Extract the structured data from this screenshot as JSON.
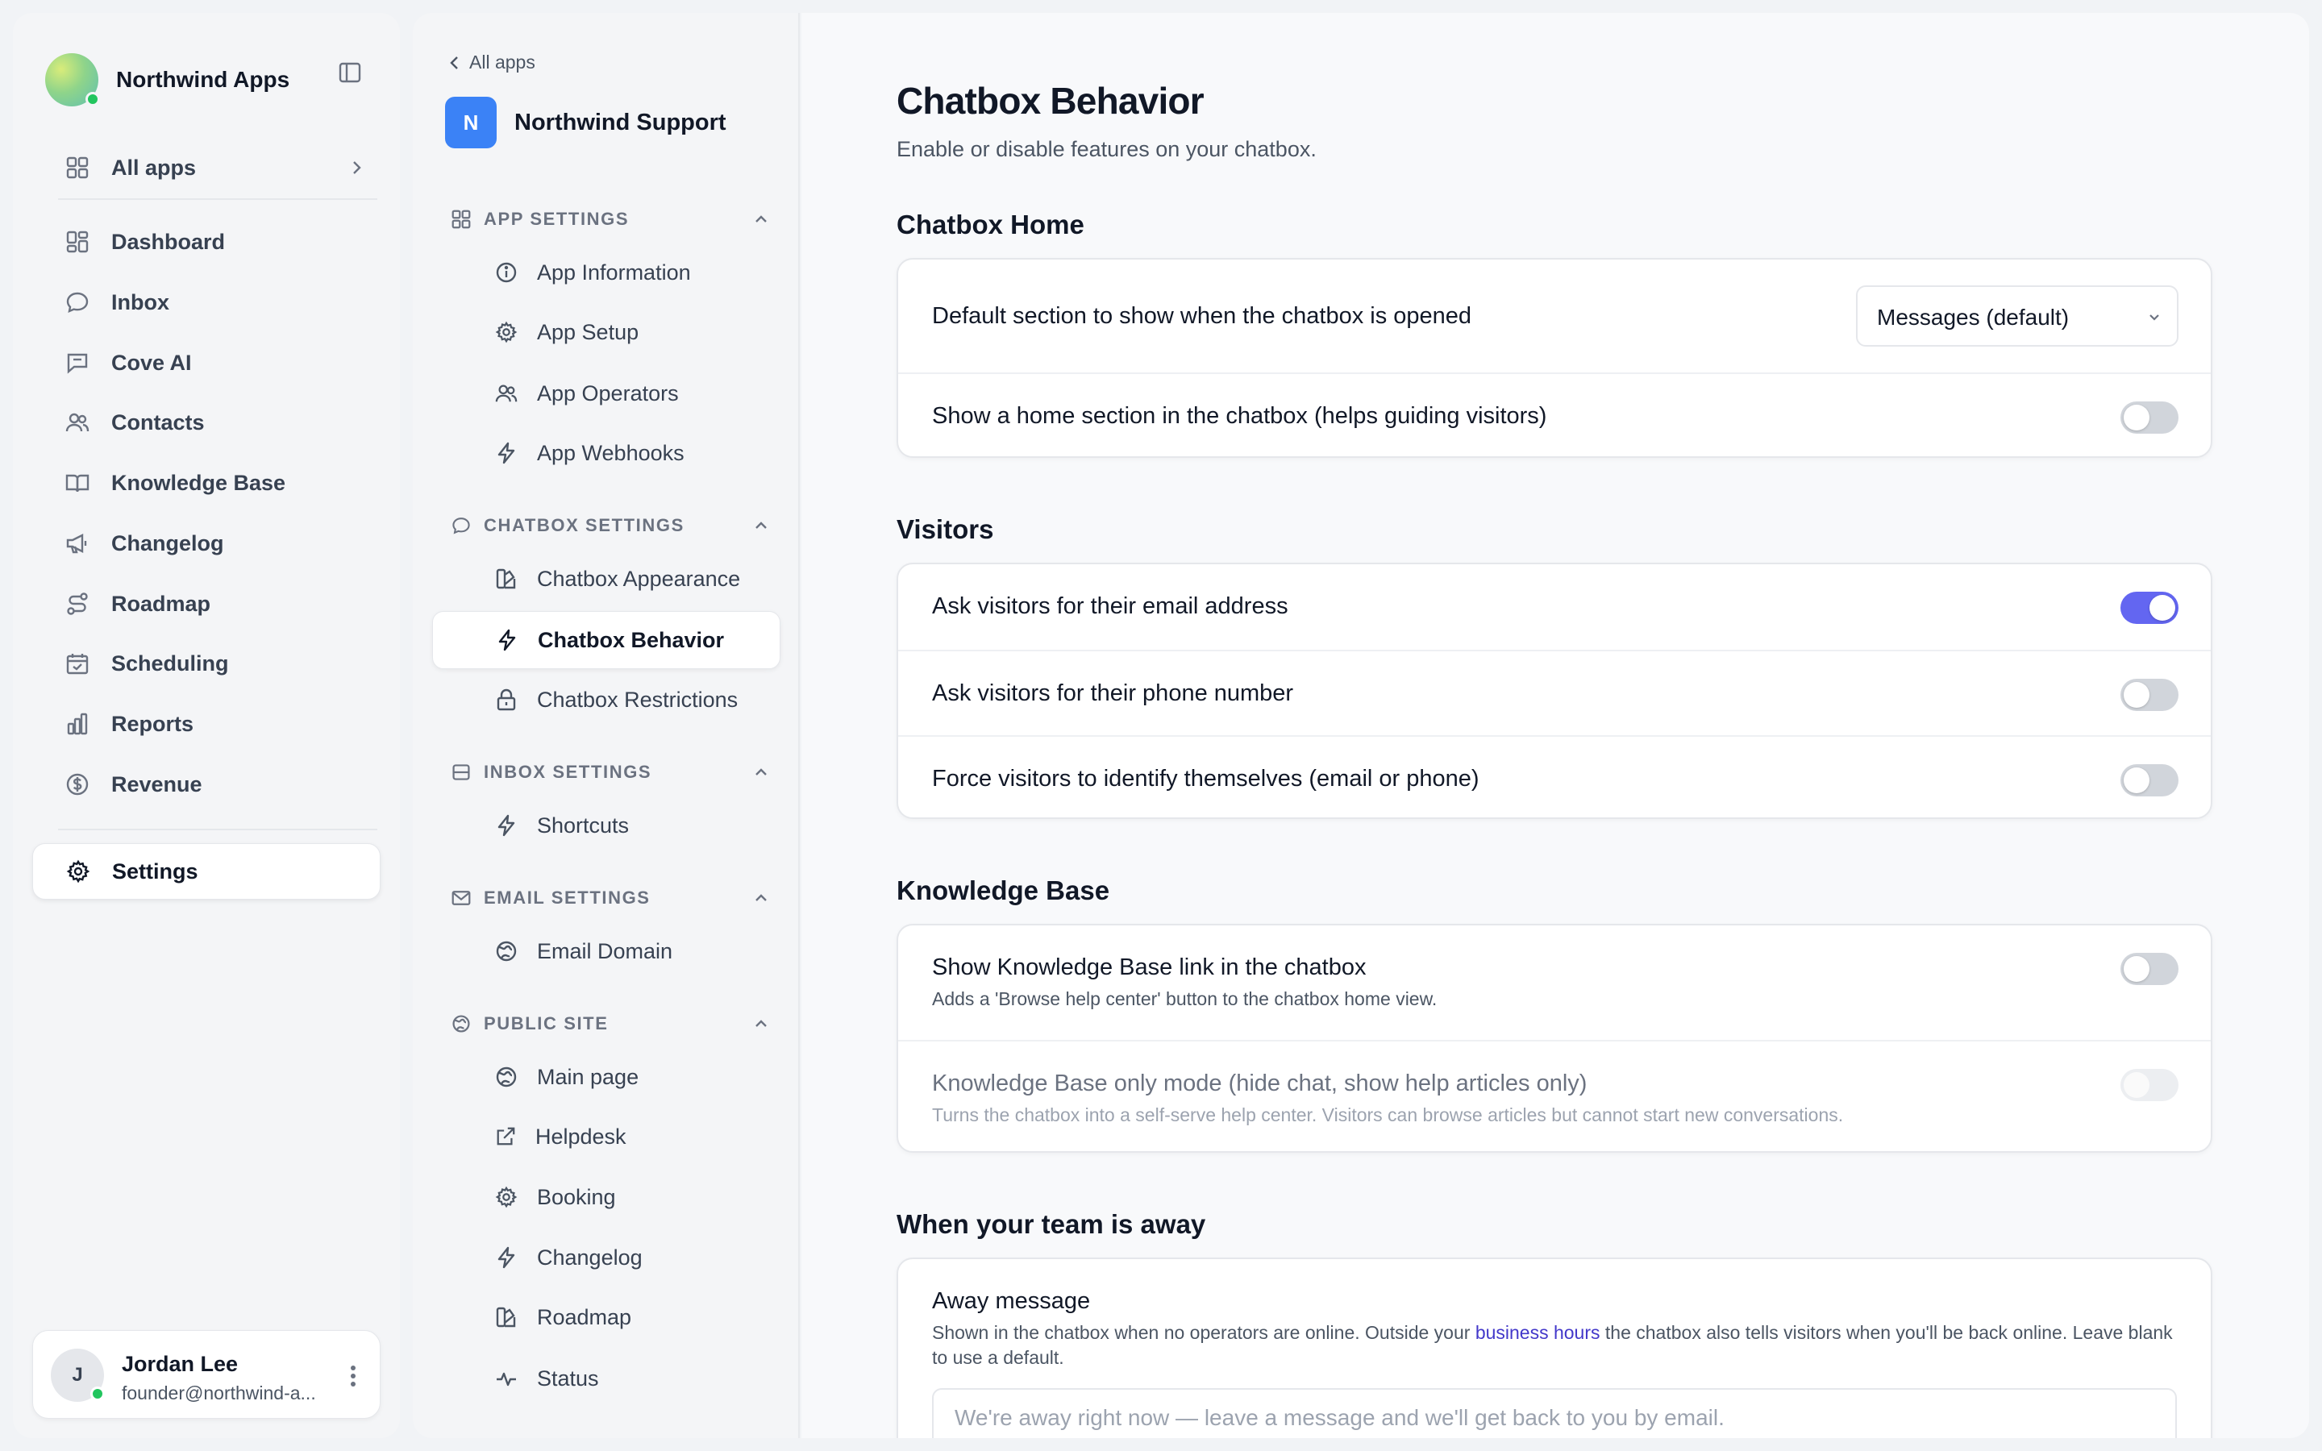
{
  "sidebar": {
    "brand": "Northwind Apps",
    "all_apps": "All apps",
    "items": [
      {
        "label": "Dashboard",
        "icon": "dashboard-icon"
      },
      {
        "label": "Inbox",
        "icon": "chat-bubble-icon"
      },
      {
        "label": "Cove AI",
        "icon": "message-square-icon"
      },
      {
        "label": "Contacts",
        "icon": "users-icon"
      },
      {
        "label": "Knowledge Base",
        "icon": "book-icon"
      },
      {
        "label": "Changelog",
        "icon": "megaphone-icon"
      },
      {
        "label": "Roadmap",
        "icon": "route-icon"
      },
      {
        "label": "Scheduling",
        "icon": "calendar-check-icon"
      },
      {
        "label": "Reports",
        "icon": "bar-chart-icon"
      },
      {
        "label": "Revenue",
        "icon": "dollar-circle-icon"
      }
    ],
    "settings": "Settings",
    "user": {
      "initial": "J",
      "name": "Jordan Lee",
      "email": "founder@northwind-a..."
    }
  },
  "settings_nav": {
    "back": "All apps",
    "app_initial": "N",
    "app_name": "Northwind Support",
    "groups": [
      {
        "title": "APP SETTINGS",
        "items": [
          "App Information",
          "App Setup",
          "App Operators",
          "App Webhooks"
        ]
      },
      {
        "title": "CHATBOX SETTINGS",
        "items": [
          "Chatbox Appearance",
          "Chatbox Behavior",
          "Chatbox Restrictions"
        ]
      },
      {
        "title": "INBOX SETTINGS",
        "items": [
          "Shortcuts"
        ]
      },
      {
        "title": "EMAIL SETTINGS",
        "items": [
          "Email Domain"
        ]
      },
      {
        "title": "PUBLIC SITE",
        "items": [
          "Main page",
          "Helpdesk",
          "Booking",
          "Changelog",
          "Roadmap",
          "Status"
        ]
      }
    ],
    "active": "Chatbox Behavior"
  },
  "main": {
    "title": "Chatbox Behavior",
    "subtitle": "Enable or disable features on your chatbox.",
    "home": {
      "title": "Chatbox Home",
      "default_section_label": "Default section to show when the chatbox is opened",
      "default_section_value": "Messages (default)",
      "show_home_label": "Show a home section in the chatbox (helps guiding visitors)",
      "show_home_on": false
    },
    "visitors": {
      "title": "Visitors",
      "rows": [
        {
          "label": "Ask visitors for their email address",
          "on": true
        },
        {
          "label": "Ask visitors for their phone number",
          "on": false
        },
        {
          "label": "Force visitors to identify themselves (email or phone)",
          "on": false
        }
      ]
    },
    "kb": {
      "title": "Knowledge Base",
      "link_label": "Show Knowledge Base link in the chatbox",
      "link_desc": "Adds a 'Browse help center' button to the chatbox home view.",
      "link_on": false,
      "only_label": "Knowledge Base only mode (hide chat, show help articles only)",
      "only_desc": "Turns the chatbox into a self-serve help center. Visitors can browse articles but cannot start new conversations.",
      "only_on": false
    },
    "away": {
      "title": "When your team is away",
      "label": "Away message",
      "desc_before": "Shown in the chatbox when no operators are online. Outside your ",
      "desc_link": "business hours",
      "desc_after": " the chatbox also tells visitors when you'll be back online. Leave blank to use a default.",
      "placeholder": "We're away right now — leave a message and we'll get back to you by email.",
      "value": ""
    }
  },
  "colors": {
    "accent": "#6366f1",
    "app_badge": "#3b82f6",
    "online": "#22c55e",
    "link": "#4338ca"
  }
}
